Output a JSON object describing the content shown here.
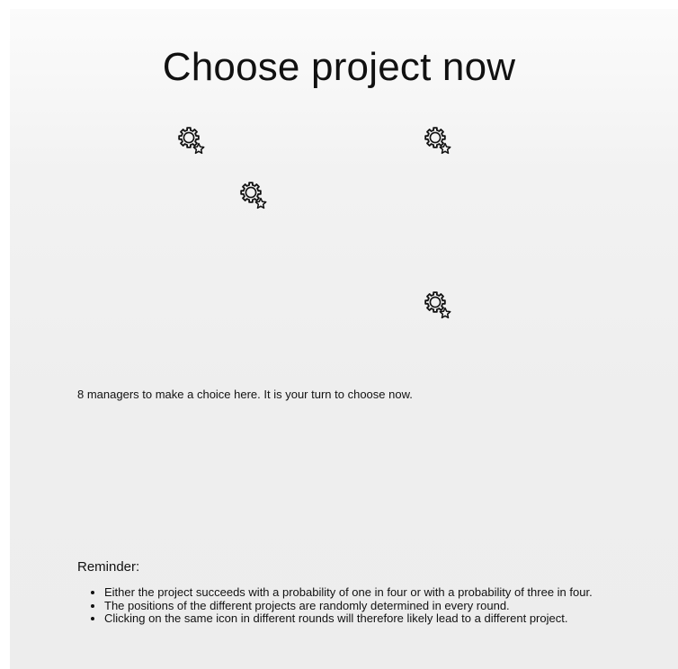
{
  "title": "Choose project now",
  "projects": [
    {
      "icon": "gear-star-icon"
    },
    {
      "icon": "gear-star-icon"
    },
    {
      "icon": "gear-star-icon"
    },
    {
      "icon": "gear-star-icon"
    }
  ],
  "status_text": "8 managers to make a choice here. It is your turn to choose now.",
  "reminder": {
    "heading": "Reminder:",
    "items": [
      "Either the project succeeds with a probability of one in four or with a probability of three in four.",
      "The positions of the different projects are randomly determined in every round.",
      "Clicking on the same icon in different rounds will therefore likely lead to a different project."
    ]
  }
}
